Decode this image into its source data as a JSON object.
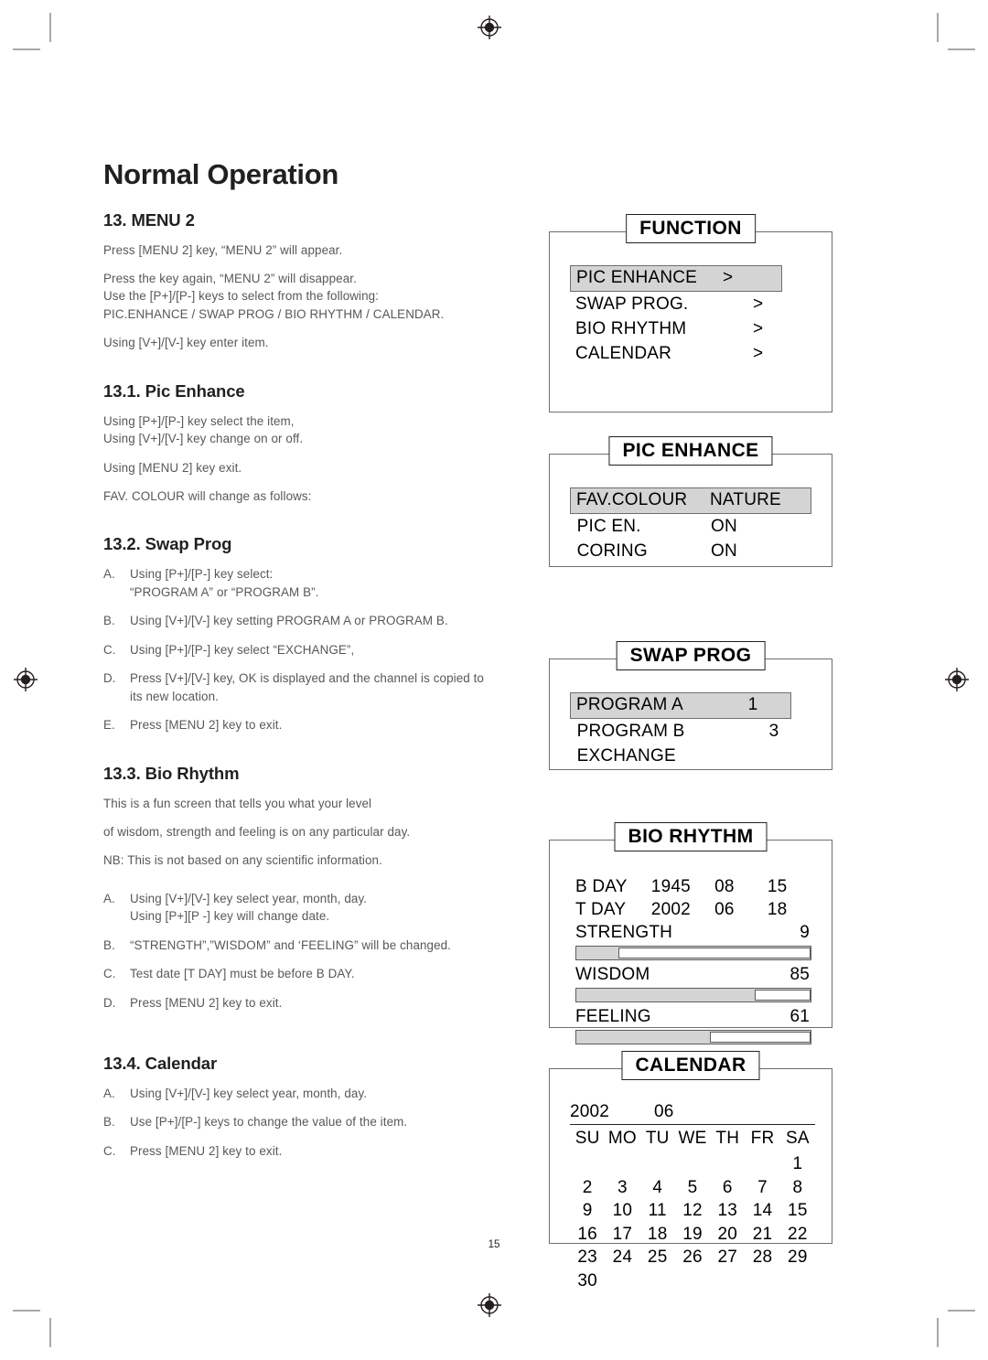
{
  "page": {
    "title": "Normal Operation",
    "number": "15"
  },
  "sections": [
    {
      "heading": "13. MENU 2",
      "paragraphs": [
        "Press [MENU 2] key, “MENU 2” will appear.",
        "Press the key again, “MENU 2” will disappear.\nUse the [P+]/[P-] keys to select from the following:\nPIC.ENHANCE / SWAP PROG / BIO RHYTHM / CALENDAR.",
        "Using [V+]/[V-] key enter item."
      ]
    },
    {
      "heading": "13.1. Pic Enhance",
      "paragraphs": [
        "Using [P+]/[P-] key select the item,\nUsing [V+]/[V-] key change on or off.",
        "Using [MENU 2] key exit.",
        "FAV. COLOUR will change as follows:"
      ]
    },
    {
      "heading": "13.2. Swap Prog",
      "items": [
        {
          "mark": "A.",
          "text": "Using [P+]/[P-] key select:\n“PROGRAM A” or “PROGRAM B”."
        },
        {
          "mark": "B.",
          "text": "Using [V+]/[V-] key setting PROGRAM A or PROGRAM B."
        },
        {
          "mark": "C.",
          "text": "Using [P+]/[P-] key select “EXCHANGE”,"
        },
        {
          "mark": "D.",
          "text": "Press [V+]/[V-] key, OK is displayed and the channel is copied to its new location."
        },
        {
          "mark": "E.",
          "text": "Press [MENU 2] key to exit."
        }
      ]
    },
    {
      "heading": "13.3. Bio Rhythm",
      "paragraphs": [
        "This is a fun screen that tells you what your level",
        "of wisdom, strength and feeling is on any particular day.",
        "NB: This is not based on any scientific information."
      ],
      "items": [
        {
          "mark": "A.",
          "text": "Using [V+]/[V-] key select year, month, day.\nUsing [P+][P -] key will change date."
        },
        {
          "mark": "B.",
          "text": "“STRENGTH”,”WISDOM” and ‘FEELING” will be changed."
        },
        {
          "mark": "C.",
          "text": "Test date [T DAY] must be before B DAY."
        },
        {
          "mark": "D.",
          "text": "Press [MENU 2] key to exit."
        }
      ]
    },
    {
      "heading": "13.4. Calendar",
      "items": [
        {
          "mark": "A.",
          "text": "Using [V+]/[V-] key select year, month, day."
        },
        {
          "mark": "B.",
          "text": "Use [P+]/[P-] keys to change the value of the item."
        },
        {
          "mark": "C.",
          "text": "Press [MENU 2] key to exit."
        }
      ]
    }
  ],
  "osd": {
    "function": {
      "title": "FUNCTION",
      "rows": [
        {
          "label": "PIC ENHANCE",
          "value": ">",
          "selected": true
        },
        {
          "label": "SWAP PROG.",
          "value": ">",
          "selected": false
        },
        {
          "label": "BIO RHYTHM",
          "value": ">",
          "selected": false
        },
        {
          "label": "CALENDAR",
          "value": ">",
          "selected": false
        }
      ]
    },
    "pic_enhance": {
      "title": "PIC ENHANCE",
      "rows": [
        {
          "label": "FAV.COLOUR",
          "value": "NATURE",
          "selected": true
        },
        {
          "label": "PIC EN.",
          "value": "ON",
          "selected": false
        },
        {
          "label": "CORING",
          "value": "ON",
          "selected": false
        }
      ]
    },
    "swap_prog": {
      "title": "SWAP PROG",
      "rows": [
        {
          "label": "PROGRAM A",
          "value": "1",
          "selected": true
        },
        {
          "label": "PROGRAM B",
          "value": "3",
          "selected": false
        },
        {
          "label": "EXCHANGE",
          "value": "",
          "selected": false
        }
      ]
    },
    "bio_rhythm": {
      "title": "BIO RHYTHM",
      "dates": [
        {
          "label": "B DAY",
          "year": "1945",
          "month": "08",
          "day": "15"
        },
        {
          "label": "T DAY",
          "year": "2002",
          "month": "06",
          "day": "18"
        }
      ],
      "meters": [
        {
          "label": "STRENGTH",
          "value": "9",
          "fill_pct": 18
        },
        {
          "label": "WISDOM",
          "value": "85",
          "fill_pct": 76
        },
        {
          "label": "FEELING",
          "value": "61",
          "fill_pct": 57
        }
      ]
    },
    "calendar": {
      "title": "CALENDAR",
      "year": "2002",
      "month": "06",
      "dow": [
        "SU",
        "MO",
        "TU",
        "WE",
        "TH",
        "FR",
        "SA"
      ],
      "weeks": [
        [
          "",
          "",
          "",
          "",
          "",
          "",
          "1"
        ],
        [
          "2",
          "3",
          "4",
          "5",
          "6",
          "7",
          "8"
        ],
        [
          "9",
          "10",
          "11",
          "12",
          "13",
          "14",
          "15"
        ],
        [
          "16",
          "17",
          "18",
          "19",
          "20",
          "21",
          "22"
        ],
        [
          "23",
          "24",
          "25",
          "26",
          "27",
          "28",
          "29"
        ],
        [
          "30",
          "",
          "",
          "",
          "",
          "",
          ""
        ]
      ]
    }
  }
}
